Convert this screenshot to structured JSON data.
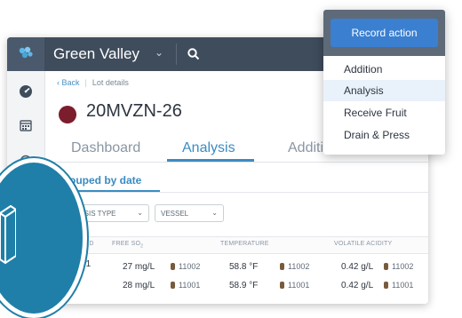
{
  "header": {
    "org_name": "Green Valley",
    "org_chevron": "⌄"
  },
  "breadcrumb": {
    "back": "‹ Back",
    "current": "Lot details"
  },
  "lot": {
    "code": "20MVZN-26",
    "color": "#7b1d2c"
  },
  "tabs": [
    {
      "label": "Dashboard"
    },
    {
      "label": "Analysis",
      "active": true
    },
    {
      "label": "Addition"
    }
  ],
  "subnav": {
    "label": "Grouped by date"
  },
  "filters": [
    {
      "label": "ANALYSIS TYPE",
      "chevron": "⌄"
    },
    {
      "label": "VESSEL",
      "chevron": "⌄"
    }
  ],
  "table": {
    "headers": [
      "RECORDED",
      "FREE SO",
      "TEMPERATURE",
      "VOLATILE ACIDITY"
    ],
    "free_so_subscript": "2",
    "rows": [
      {
        "recorded": "11/01/21",
        "free_so": "27 mg/L",
        "free_so_vessel": "11002",
        "temperature": "58.8 °F",
        "temperature_vessel": "11002",
        "va": "0.42 g/L",
        "va_vessel": "11002"
      },
      {
        "recorded": "",
        "free_so": "28 mg/L",
        "free_so_vessel": "11001",
        "temperature": "58.9 °F",
        "temperature_vessel": "11001",
        "va": "0.42 g/L",
        "va_vessel": "11001"
      }
    ]
  },
  "action_menu": {
    "button_label": "Record action",
    "items": [
      {
        "label": "Addition"
      },
      {
        "label": "Analysis",
        "active": true
      },
      {
        "label": "Receive Fruit"
      },
      {
        "label": "Drain & Press"
      }
    ]
  },
  "colors": {
    "accent": "#3a8cc2",
    "topbar": "#3f4c5c",
    "button": "#3b7fd0"
  }
}
